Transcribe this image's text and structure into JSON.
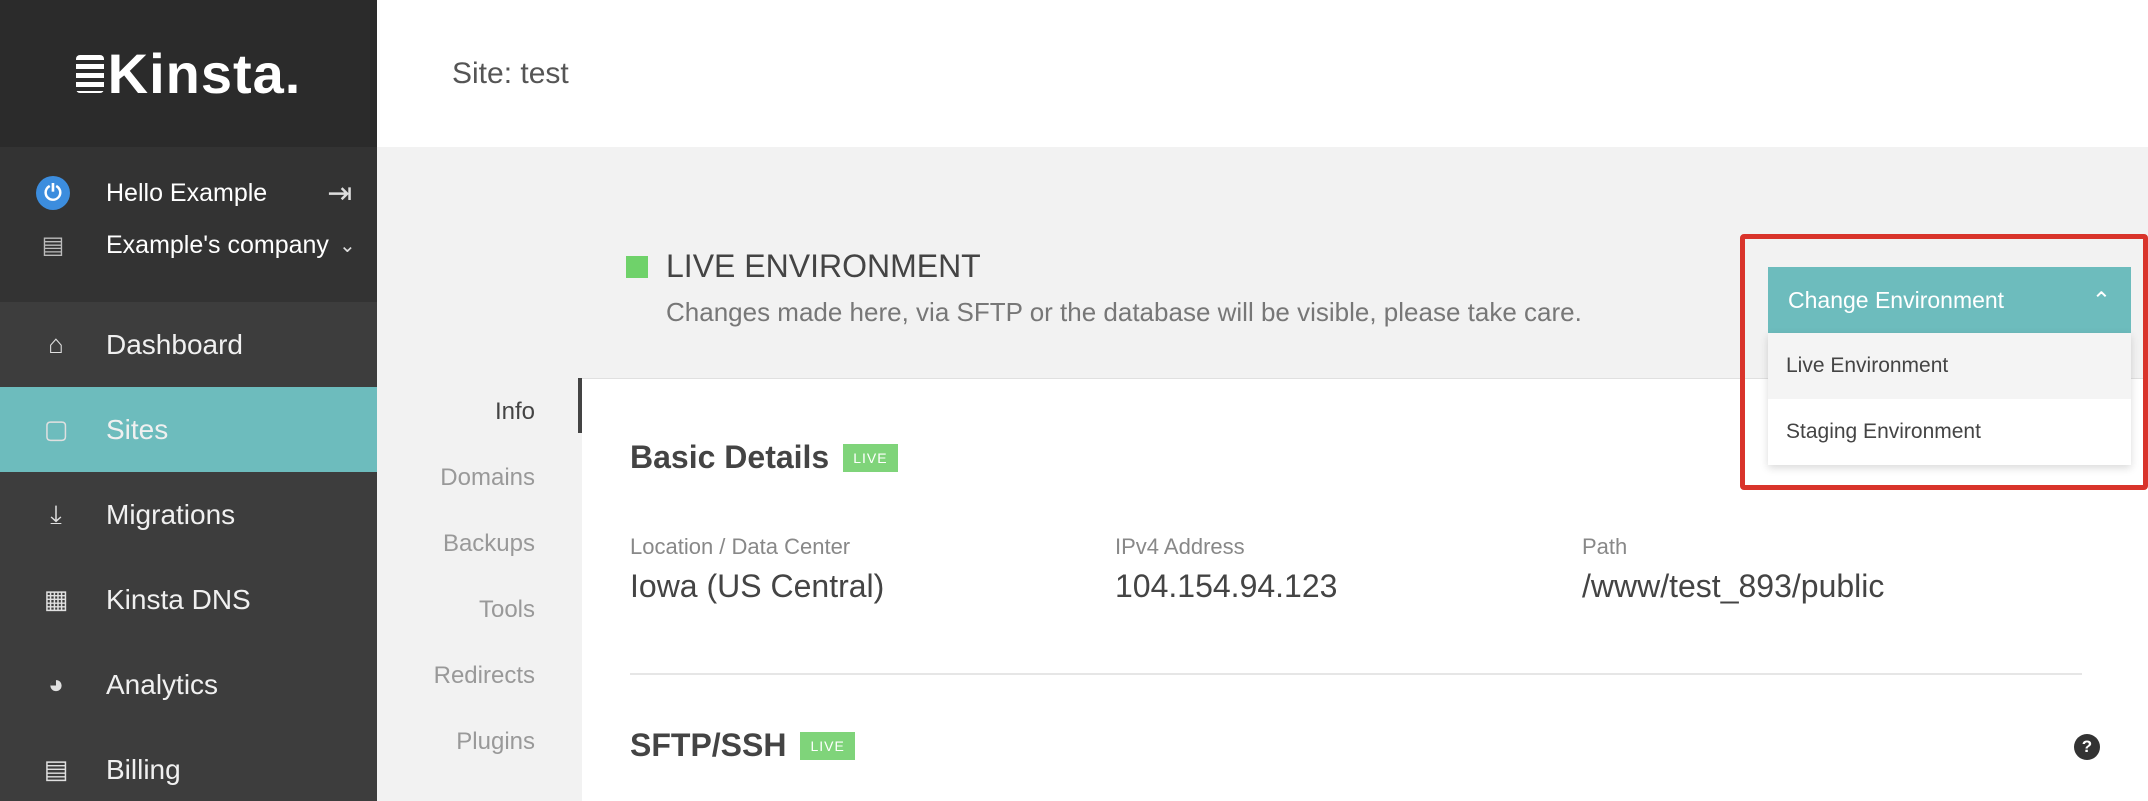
{
  "sidebar": {
    "logo": "Kinsta.",
    "user": {
      "name": "Hello Example",
      "company": "Example's company"
    },
    "nav": [
      {
        "label": "Dashboard",
        "icon": "home-icon",
        "active": false
      },
      {
        "label": "Sites",
        "icon": "sites-icon",
        "active": true
      },
      {
        "label": "Migrations",
        "icon": "migrations-icon",
        "active": false
      },
      {
        "label": "Kinsta DNS",
        "icon": "dns-icon",
        "active": false
      },
      {
        "label": "Analytics",
        "icon": "analytics-icon",
        "active": false
      },
      {
        "label": "Billing",
        "icon": "billing-icon",
        "active": false
      }
    ]
  },
  "header": {
    "title": "Site: test"
  },
  "environment": {
    "title": "LIVE ENVIRONMENT",
    "description": "Changes made here, via SFTP or the database will be visible, please take care.",
    "dropdown": {
      "button": "Change Environment",
      "options": [
        "Live Environment",
        "Staging Environment"
      ]
    }
  },
  "tabs": [
    "Info",
    "Domains",
    "Backups",
    "Tools",
    "Redirects",
    "Plugins"
  ],
  "basic_details": {
    "title": "Basic Details",
    "badge": "LIVE",
    "fields": [
      {
        "label": "Location / Data Center",
        "value": "Iowa (US Central)"
      },
      {
        "label": "IPv4 Address",
        "value": "104.154.94.123"
      },
      {
        "label": "Path",
        "value": "/www/test_893/public"
      }
    ]
  },
  "sftp": {
    "title": "SFTP/SSH",
    "badge": "LIVE"
  },
  "colors": {
    "accent": "#6dbcbd",
    "live": "#7fd47a",
    "highlight": "#d9342b",
    "sidebar": "#3d3d3d"
  }
}
